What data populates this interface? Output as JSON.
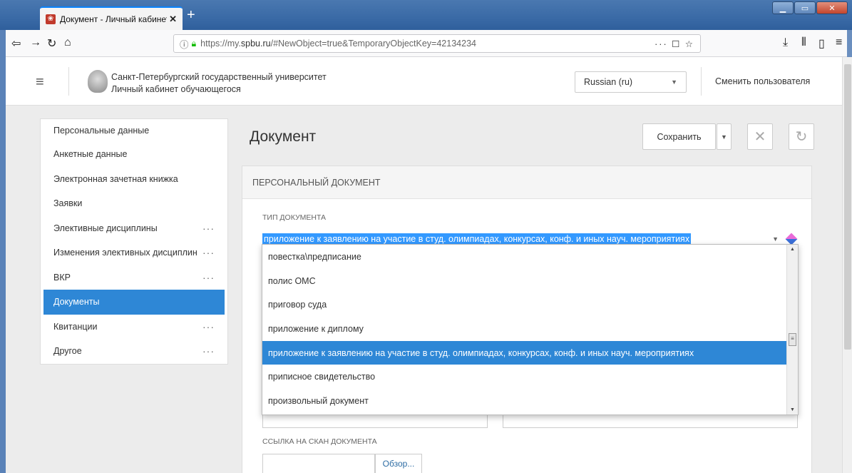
{
  "browser": {
    "tab_title": "Документ - Личный кабинет о",
    "tab_close": "✕",
    "new_tab": "+",
    "url_prefix": "https://my.",
    "url_domain": "spbu.ru",
    "url_rest": "/#NewObject=true&TemporaryObjectKey=42134234",
    "url_actions": "··· ☐ ☆",
    "nav_icons": [
      "back-icon",
      "forward-icon",
      "reload-icon",
      "home-icon",
      "info-icon",
      "lock-icon",
      "download-icon",
      "library-icon",
      "sidebar-icon",
      "menu-icon"
    ]
  },
  "header": {
    "university_line1": "Санкт-Петербургский государственный университет",
    "university_line2": "Личный кабинет обучающегося",
    "language": "Russian (ru)",
    "switch_user": "Сменить пользователя"
  },
  "sidebar": {
    "items": [
      {
        "label": "Персональные данные",
        "more": false
      },
      {
        "label": "Анкетные данные",
        "more": false
      },
      {
        "label": "Электронная зачетная книжка",
        "more": false
      },
      {
        "label": "Заявки",
        "more": false
      },
      {
        "label": "Элективные дисциплины",
        "more": true
      },
      {
        "label": "Изменения элективных дисциплин",
        "more": true
      },
      {
        "label": "ВКР",
        "more": true
      },
      {
        "label": "Документы",
        "more": false,
        "active": true
      },
      {
        "label": "Квитанции",
        "more": true
      },
      {
        "label": "Другое",
        "more": true
      }
    ],
    "dots": "···"
  },
  "main": {
    "title": "Документ",
    "save_label": "Сохранить",
    "card_title": "ПЕРСОНАЛЬНЫЙ ДОКУМЕНТ",
    "doc_type_label": "ТИП ДОКУМЕНТА",
    "doc_type_value": "приложение к заявлению на участие в студ. олимпиадах, конкурсах, конф. и иных науч. мероприятиях",
    "scan_label": "ССЫЛКА НА СКАН ДОКУМЕНТА",
    "browse_label": "Обзор..."
  },
  "dropdown": {
    "options": [
      "повестка\\предписание",
      "полис ОМС",
      "приговор суда",
      "приложение к диплому",
      "приложение к заявлению на участие в студ. олимпиадах, конкурсах, конф. и иных науч. мероприятиях",
      "приписное свидетельство",
      "произвольный документ"
    ],
    "selected_index": 4
  },
  "colors": {
    "accent": "#2e87d6",
    "selection": "#3399ff"
  }
}
